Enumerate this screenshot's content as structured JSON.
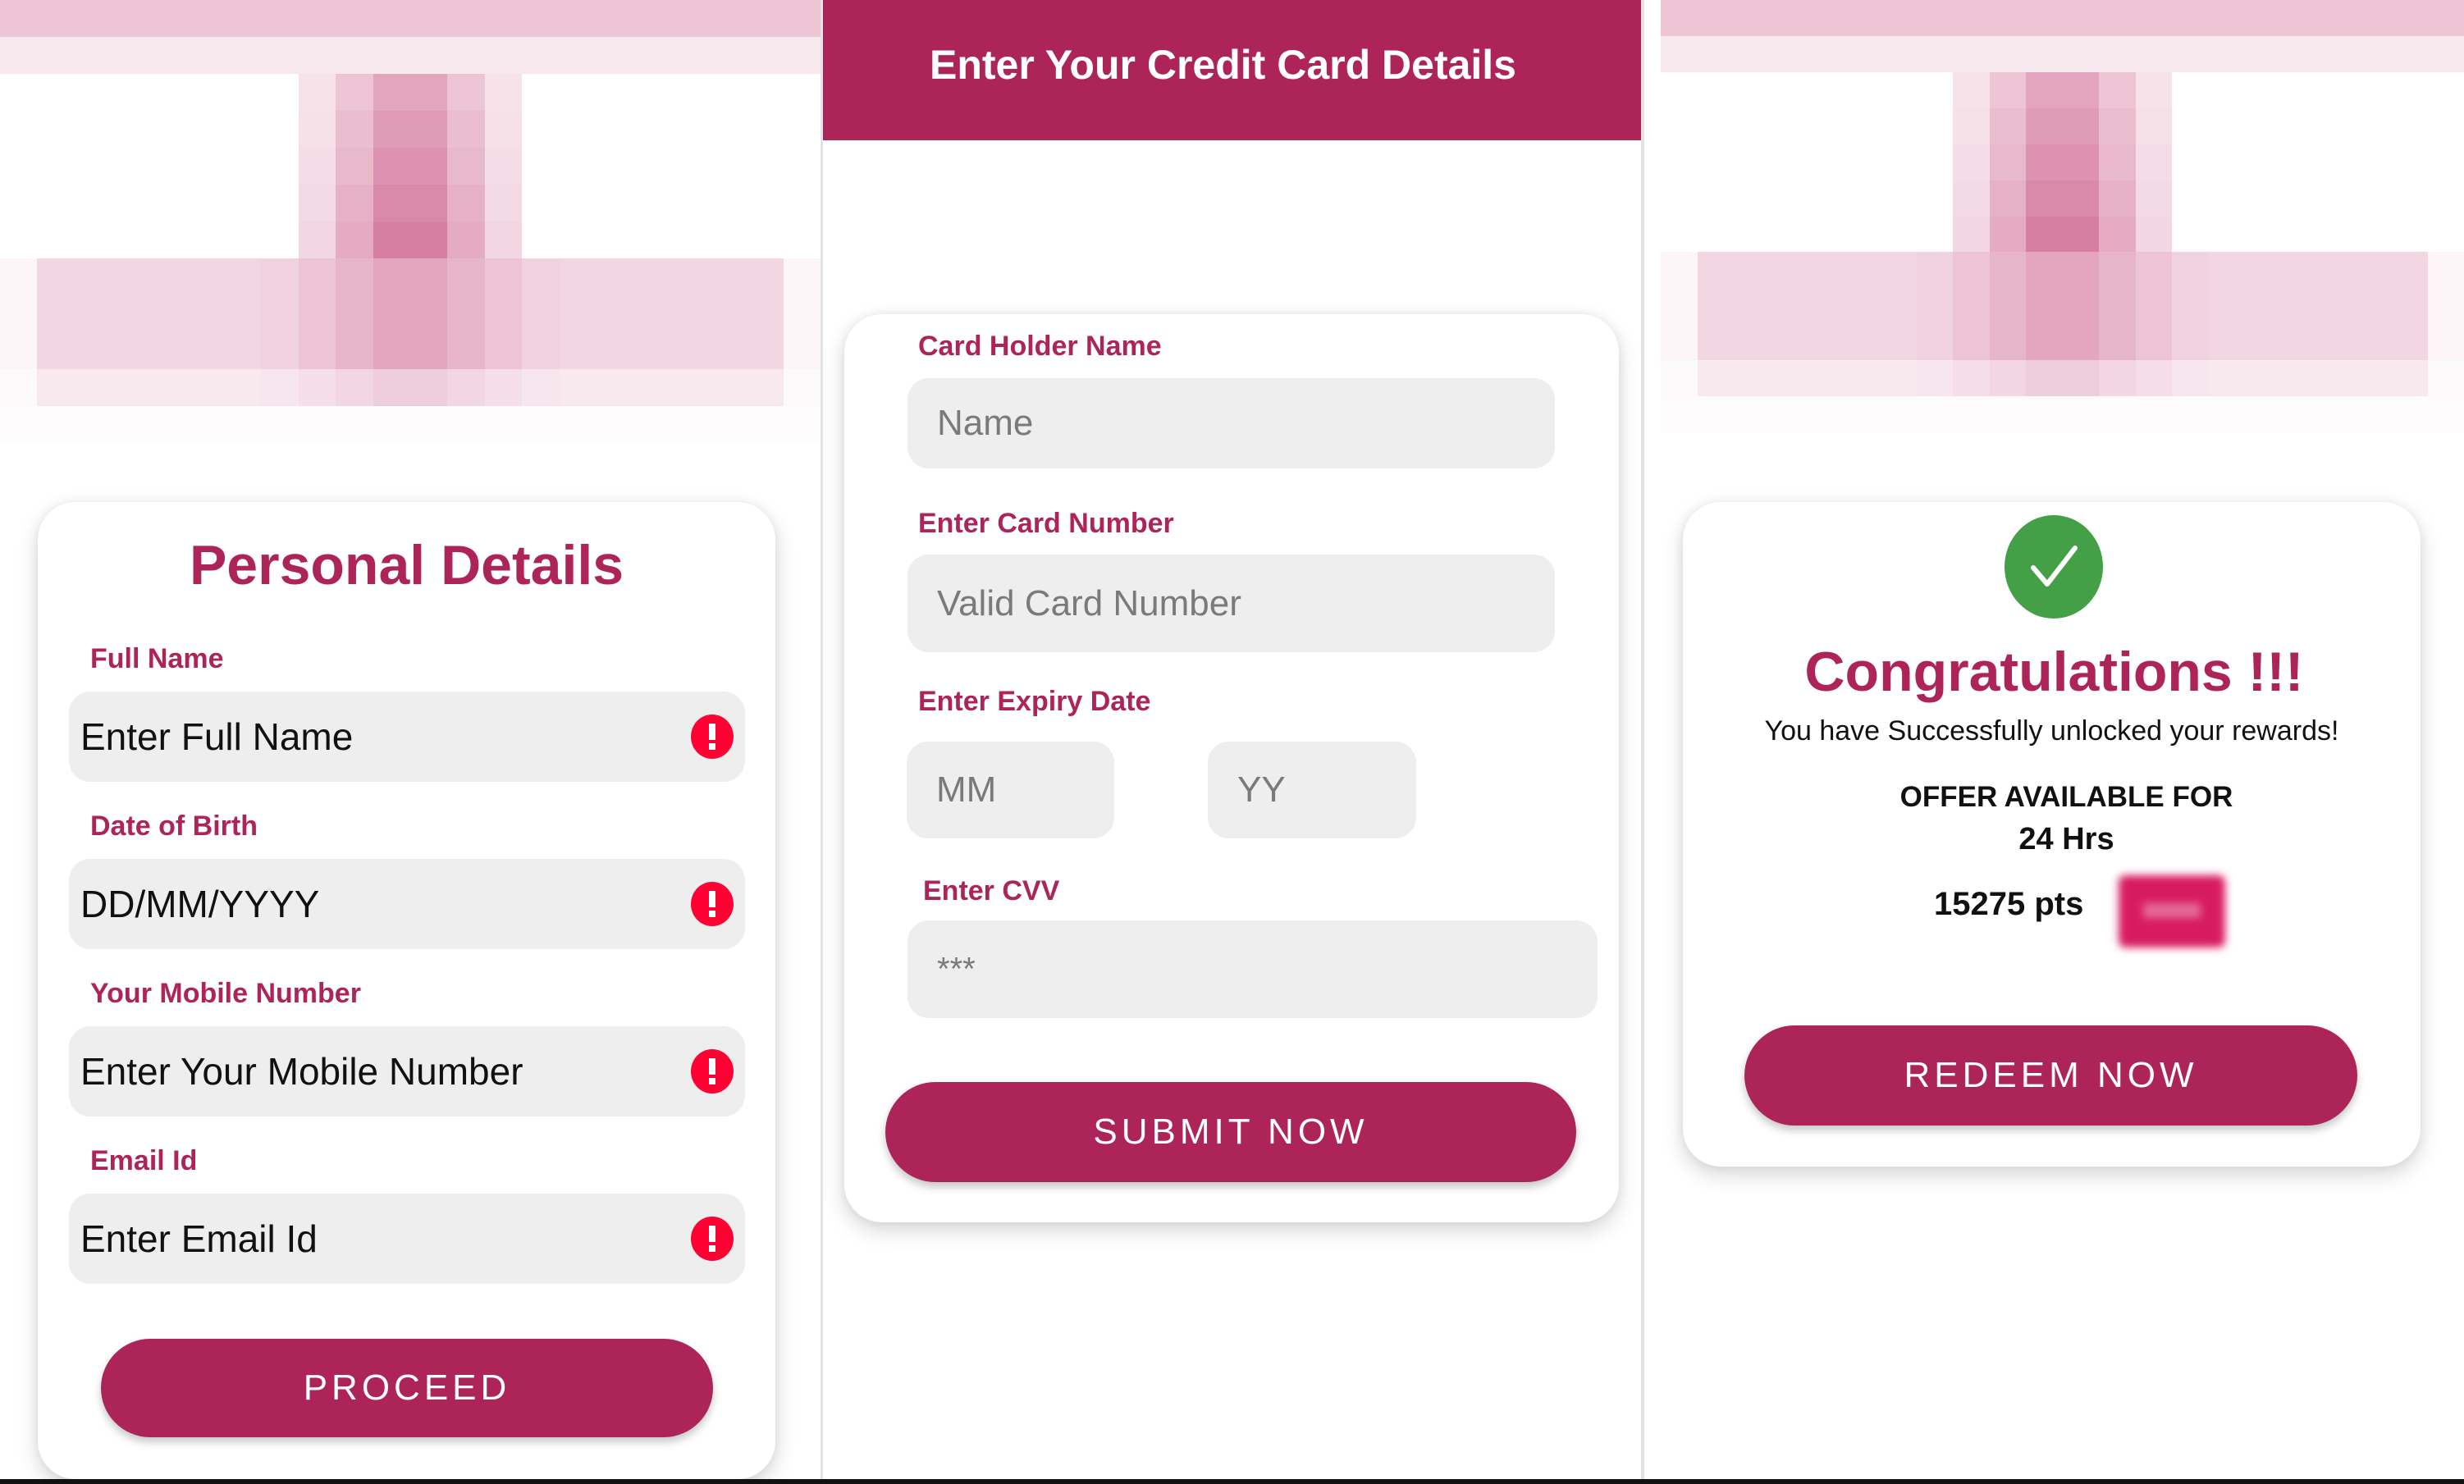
{
  "theme": {
    "accent": "#ad2459",
    "error": "#ff0033",
    "success": "#43a047",
    "field_bg": "#eeeeee"
  },
  "screens": {
    "personal": {
      "title": "Personal Details",
      "fields": [
        {
          "label": "Full Name",
          "value": "Enter Full Name",
          "status_icon": "error-icon"
        },
        {
          "label": "Date of Birth",
          "value": "DD/MM/YYYY",
          "status_icon": "error-icon"
        },
        {
          "label": "Your Mobile Number",
          "value": "Enter Your Mobile Number",
          "status_icon": "error-icon"
        },
        {
          "label": "Email Id",
          "value": "Enter Email Id",
          "status_icon": "error-icon"
        }
      ],
      "button": "PROCEED"
    },
    "credit_card": {
      "header_title": "Enter Your Credit Card Details",
      "card_holder_label": "Card Holder Name",
      "card_holder_placeholder": "Name",
      "card_number_label": "Enter Card Number",
      "card_number_placeholder": "Valid Card Number",
      "expiry_label": "Enter Expiry Date",
      "expiry_month_placeholder": "MM",
      "expiry_year_placeholder": "YY",
      "cvv_label": "Enter CVV",
      "cvv_placeholder": "***",
      "button": "SUBMIT NOW"
    },
    "success": {
      "icon": "check-circle-icon",
      "title": "Congratulations !!!",
      "subtitle": "You have Successfully unlocked your rewards!",
      "offer_label": "OFFER AVAILABLE FOR",
      "offer_duration": "24 Hrs",
      "points": "15275 pts",
      "button": "REDEEM NOW"
    }
  }
}
